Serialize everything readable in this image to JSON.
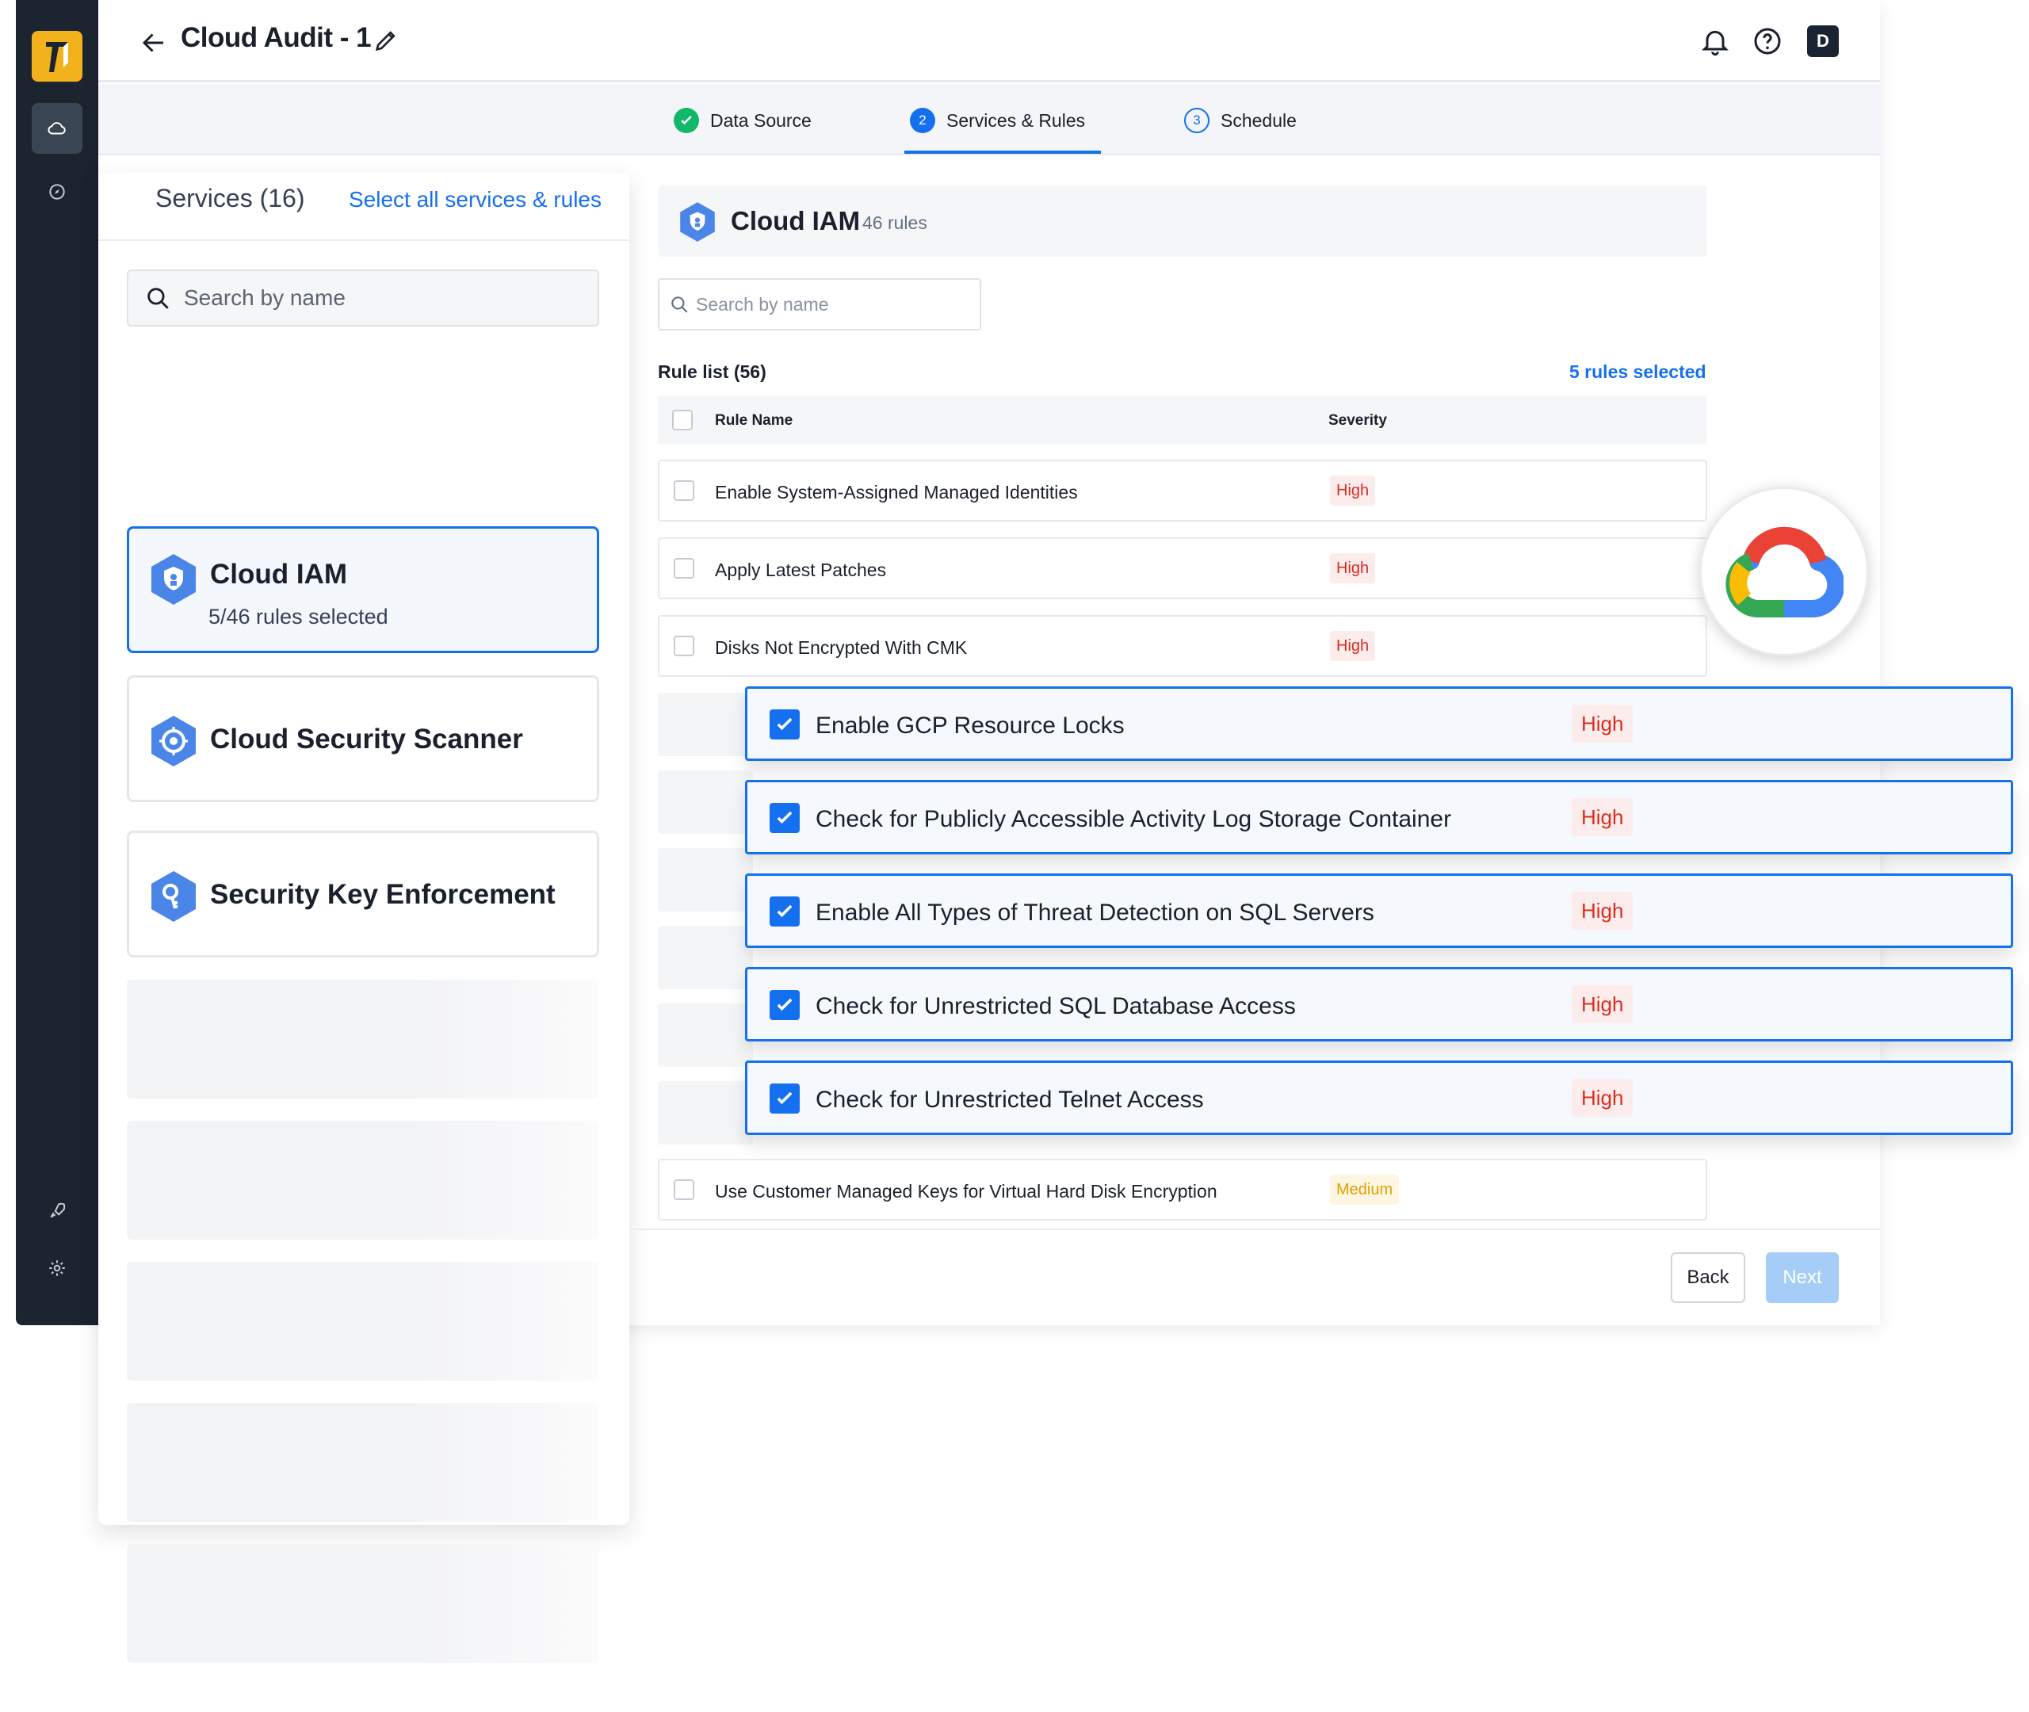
{
  "header": {
    "title": "Cloud Audit - 1",
    "avatar_initial": "D"
  },
  "stepper": {
    "steps": [
      {
        "label": "Data Source",
        "status": "complete"
      },
      {
        "label": "Services & Rules",
        "number": "2",
        "status": "active"
      },
      {
        "label": "Schedule",
        "number": "3",
        "status": "upcoming"
      }
    ]
  },
  "services": {
    "title": "Services (16)",
    "select_all": "Select all services & rules",
    "search_placeholder": "Search by name",
    "items": [
      {
        "name": "Cloud IAM",
        "sub": "5/46 rules selected",
        "selected": true,
        "icon": "shield-icon"
      },
      {
        "name": "Cloud Security Scanner",
        "sub": "",
        "selected": false,
        "icon": "scanner-icon"
      },
      {
        "name": "Security Key Enforcement",
        "sub": "",
        "selected": false,
        "icon": "key-icon"
      }
    ]
  },
  "rules": {
    "service_name": "Cloud IAM",
    "service_count": "46 rules",
    "search_placeholder": "Search by name",
    "list_label": "Rule list (56)",
    "selected_label": "5 rules selected",
    "columns": {
      "name": "Rule Name",
      "severity": "Severity"
    },
    "unchecked": [
      {
        "name": "Enable System-Assigned Managed Identities",
        "severity": "High"
      },
      {
        "name": "Apply Latest Patches",
        "severity": "High"
      },
      {
        "name": "Disks Not Encrypted With CMK",
        "severity": "High"
      },
      {
        "name": "Use Customer Managed Keys for Virtual Hard Disk Encryption",
        "severity": "Medium"
      }
    ],
    "checked": [
      {
        "name": "Enable GCP Resource Locks",
        "severity": "High"
      },
      {
        "name": "Check for Publicly Accessible Activity Log Storage Container",
        "severity": "High"
      },
      {
        "name": "Enable All Types of Threat Detection on SQL Servers",
        "severity": "High"
      },
      {
        "name": "Check for Unrestricted SQL Database Access",
        "severity": "High"
      },
      {
        "name": "Check for Unrestricted Telnet Access",
        "severity": "High"
      }
    ]
  },
  "footer": {
    "back_label": "Back",
    "next_label": "Next"
  },
  "colors": {
    "accent": "#1570ef",
    "sidebar": "#1c2430",
    "high": "#d92d20",
    "medium": "#e0a100",
    "success": "#12b76a"
  }
}
